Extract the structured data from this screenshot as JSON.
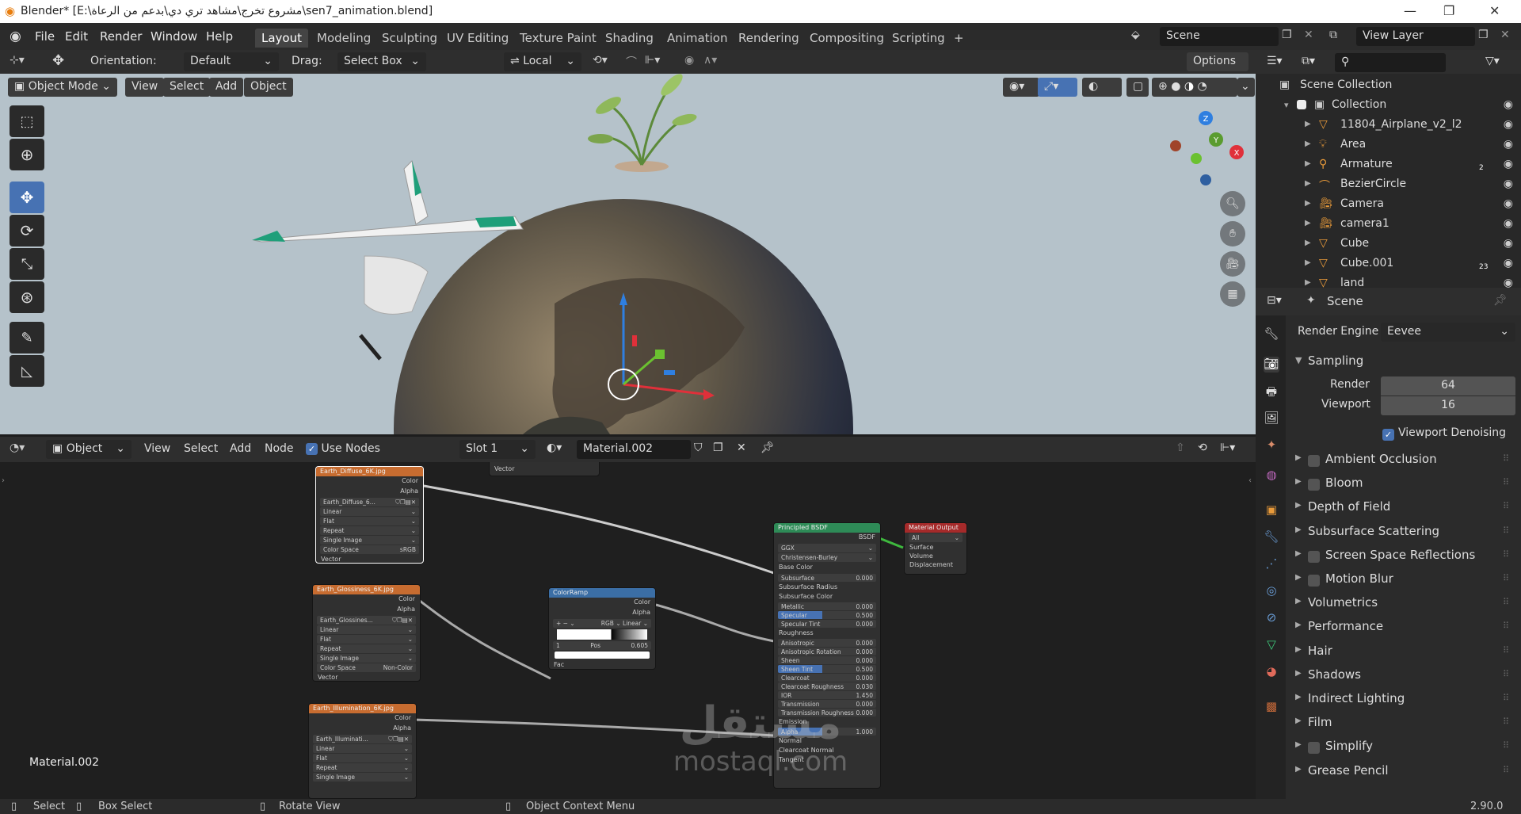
{
  "titlebar": {
    "title": "Blender* [E:\\مشروع تخرج\\مشاهد تري دي\\بدعم من الرعاة\\sen7_animation.blend]"
  },
  "menu": [
    "File",
    "Edit",
    "Render",
    "Window",
    "Help"
  ],
  "workspaces": [
    "Layout",
    "Modeling",
    "Sculpting",
    "UV Editing",
    "Texture Paint",
    "Shading",
    "Animation",
    "Rendering",
    "Compositing",
    "Scripting"
  ],
  "scene": {
    "name": "Scene",
    "view_layer": "View Layer"
  },
  "viewport": {
    "orientation_label": "Orientation:",
    "orientation_value": "Default",
    "drag_label": "Drag:",
    "drag_value": "Select Box",
    "pivot_value": "Local",
    "options": "Options",
    "mode": "Object Mode",
    "menus": [
      "View",
      "Select",
      "Add",
      "Object"
    ]
  },
  "node_editor": {
    "type": "Object",
    "menus": [
      "View",
      "Select",
      "Add",
      "Node"
    ],
    "use_nodes": "Use Nodes",
    "slot": "Slot 1",
    "material": "Material.002",
    "corner_label": "Material.002",
    "vector_out": "Vector",
    "nodes": {
      "diffuse": {
        "title": "Earth_Diffuse_6K.jpg",
        "color": "Color",
        "alpha": "Alpha",
        "img": "Earth_Diffuse_6...",
        "interp": "Linear",
        "proj": "Flat",
        "ext": "Repeat",
        "src": "Single Image",
        "cs_label": "Color Space",
        "cs_value": "sRGB",
        "vector": "Vector"
      },
      "gloss": {
        "title": "Earth_Glossiness_6K.jpg",
        "color": "Color",
        "alpha": "Alpha",
        "img": "Earth_Glossines...",
        "interp": "Linear",
        "proj": "Flat",
        "ext": "Repeat",
        "src": "Single Image",
        "cs_label": "Color Space",
        "cs_value": "Non-Color",
        "vector": "Vector"
      },
      "illum": {
        "title": "Earth_Illumination_6K.jpg",
        "color": "Color",
        "alpha": "Alpha",
        "img": "Earth_Illuminati...",
        "interp": "Linear",
        "proj": "Flat",
        "ext": "Repeat",
        "src": "Single Image"
      },
      "ramp": {
        "title": "ColorRamp",
        "color": "Color",
        "alpha": "Alpha",
        "mode": "RGB",
        "interp": "Linear",
        "index": "1",
        "pos_label": "Pos",
        "pos": "0.605",
        "fac": "Fac"
      },
      "bsdf": {
        "title": "Principled BSDF",
        "out": "BSDF",
        "dist": "GGX",
        "sss": "Christensen-Burley",
        "base": "Base Color",
        "rows": [
          [
            "Subsurface",
            "0.000"
          ],
          [
            "Subsurface Radius",
            ""
          ],
          [
            "Subsurface Color",
            ""
          ],
          [
            "Metallic",
            "0.000"
          ],
          [
            "Specular",
            "0.500"
          ],
          [
            "Specular Tint",
            "0.000"
          ],
          [
            "Roughness",
            ""
          ],
          [
            "Anisotropic",
            "0.000"
          ],
          [
            "Anisotropic Rotation",
            "0.000"
          ],
          [
            "Sheen",
            "0.000"
          ],
          [
            "Sheen Tint",
            "0.500"
          ],
          [
            "Clearcoat",
            "0.000"
          ],
          [
            "Clearcoat Roughness",
            "0.030"
          ],
          [
            "IOR",
            "1.450"
          ],
          [
            "Transmission",
            "0.000"
          ],
          [
            "Transmission Roughness",
            "0.000"
          ],
          [
            "Emission",
            ""
          ],
          [
            "Alpha",
            "1.000"
          ],
          [
            "Normal",
            ""
          ],
          [
            "Clearcoat Normal",
            ""
          ],
          [
            "Tangent",
            ""
          ]
        ]
      },
      "output": {
        "title": "Material Output",
        "target": "All",
        "surface": "Surface",
        "volume": "Volume",
        "displacement": "Displacement"
      }
    }
  },
  "outliner": {
    "root": "Scene Collection",
    "collection": "Collection",
    "items": [
      {
        "name": "11804_Airplane_v2_l2",
        "icon": "mesh-icon"
      },
      {
        "name": "Area",
        "icon": "light-icon"
      },
      {
        "name": "Armature",
        "icon": "armature-icon",
        "count": "2"
      },
      {
        "name": "BezierCircle",
        "icon": "curve-icon"
      },
      {
        "name": "Camera",
        "icon": "camera-icon"
      },
      {
        "name": "camera1",
        "icon": "camera-icon"
      },
      {
        "name": "Cube",
        "icon": "mesh-icon"
      },
      {
        "name": "Cube.001",
        "icon": "mesh-icon",
        "count": "23"
      },
      {
        "name": "land",
        "icon": "mesh-icon"
      }
    ]
  },
  "properties": {
    "context": "Scene",
    "render_engine_label": "Render Engine",
    "render_engine": "Eevee",
    "sampling": "Sampling",
    "render_label": "Render",
    "render_value": "64",
    "viewport_label": "Viewport",
    "viewport_value": "16",
    "denoise": "Viewport Denoising",
    "panels": [
      {
        "label": "Ambient Occlusion",
        "check": true
      },
      {
        "label": "Bloom",
        "check": true
      },
      {
        "label": "Depth of Field",
        "check": false
      },
      {
        "label": "Subsurface Scattering",
        "check": false
      },
      {
        "label": "Screen Space Reflections",
        "check": true
      },
      {
        "label": "Motion Blur",
        "check": true
      },
      {
        "label": "Volumetrics",
        "check": false
      },
      {
        "label": "Performance",
        "check": false
      },
      {
        "label": "Hair",
        "check": false
      },
      {
        "label": "Shadows",
        "check": false
      },
      {
        "label": "Indirect Lighting",
        "check": false
      },
      {
        "label": "Film",
        "check": false
      },
      {
        "label": "Simplify",
        "check": true
      },
      {
        "label": "Grease Pencil",
        "check": false
      }
    ]
  },
  "statusbar": {
    "select": "Select",
    "box": "Box Select",
    "rotate": "Rotate View",
    "context": "Object Context Menu",
    "version": "2.90.0"
  },
  "watermark": {
    "arabic": "مستقل",
    "latin": "mostaql.com"
  },
  "colors": {
    "accent": "#4772b3",
    "image_node": "#c76c30",
    "converter": "#3b6ea5",
    "shader": "#2e8b57",
    "output": "#a52a2a"
  }
}
